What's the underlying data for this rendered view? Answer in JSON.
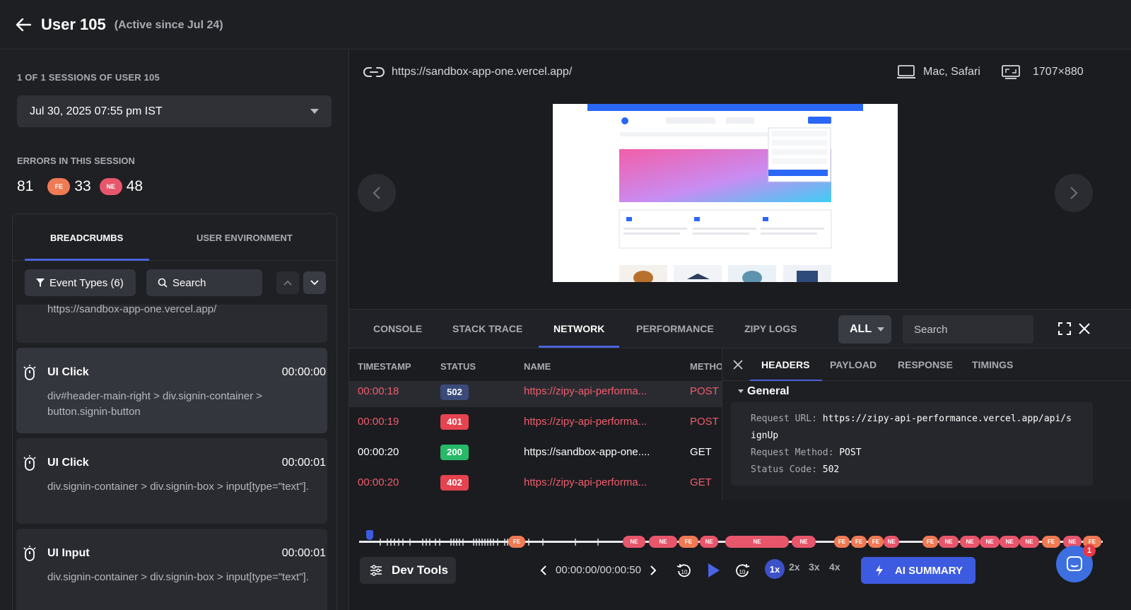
{
  "header": {
    "title": "User 105",
    "subtitle": "(Active since Jul 24)"
  },
  "sidebar": {
    "sessions_label": "1 OF 1 SESSIONS OF USER 105",
    "session_value": "Jul 30, 2025 07:55 pm IST",
    "errors_label": "ERRORS IN THIS SESSION",
    "errors_total": "81",
    "fe_badge": "FE",
    "fe_count": "33",
    "ne_badge": "NE",
    "ne_count": "48",
    "tabs": [
      "BREADCRUMBS",
      "USER ENVIRONMENT"
    ],
    "event_types_label": "Event Types (6)",
    "search_label": "Search",
    "first_item_text": "https://sandbox-app-one.vercel.app/",
    "items": [
      {
        "title": "UI Click",
        "time": "00:00:00",
        "desc": "div#header-main-right > div.signin-container > button.signin-button"
      },
      {
        "title": "UI Click",
        "time": "00:00:01",
        "desc": "div.signin-container > div.signin-box > input[type=\"text\"]."
      },
      {
        "title": "UI Input",
        "time": "00:00:01",
        "desc": "div.signin-container > div.signin-box > input[type=\"text\"]."
      }
    ]
  },
  "viewer": {
    "url": "https://sandbox-app-one.vercel.app/",
    "device": "Mac, Safari",
    "resolution": "1707×880"
  },
  "devtools": {
    "tabs": [
      "CONSOLE",
      "STACK TRACE",
      "NETWORK",
      "PERFORMANCE",
      "ZIPY LOGS"
    ],
    "active_tab": "NETWORK",
    "filter": "ALL",
    "search_placeholder": "Search",
    "columns": [
      "TIMESTAMP",
      "STATUS",
      "NAME",
      "METHO"
    ],
    "rows": [
      {
        "timestamp": "00:00:18",
        "status": "502",
        "name": "https://zipy-api-performa...",
        "method": "POST"
      },
      {
        "timestamp": "00:00:19",
        "status": "401",
        "name": "https://zipy-api-performa...",
        "method": "POST"
      },
      {
        "timestamp": "00:00:20",
        "status": "200",
        "name": "https://sandbox-app-one....",
        "method": "GET"
      },
      {
        "timestamp": "00:00:20",
        "status": "402",
        "name": "https://zipy-api-performa...",
        "method": "GET"
      }
    ],
    "detail_tabs": [
      "HEADERS",
      "PAYLOAD",
      "RESPONSE",
      "TIMINGS"
    ],
    "general": {
      "title": "General",
      "request_url_label": "Request URL:",
      "request_url": "https://zipy-api-performance.vercel.app/api/signUp",
      "method_label": "Request Method:",
      "method": "POST",
      "status_label": "Status Code:",
      "status": "502"
    }
  },
  "player": {
    "devtools_label": "Dev Tools",
    "time": "00:00:00/00:00:50",
    "speeds": [
      "1x",
      "2x",
      "3x",
      "4x"
    ],
    "ai_label": "AI SUMMARY",
    "chat_badge": "1"
  },
  "colors": {
    "accent": "#4a63d9",
    "fe": "#f07a54",
    "ne": "#e8566c",
    "status_502": "#3a4a7a",
    "status_4xx": "#e5434f",
    "status_200": "#27b968"
  }
}
